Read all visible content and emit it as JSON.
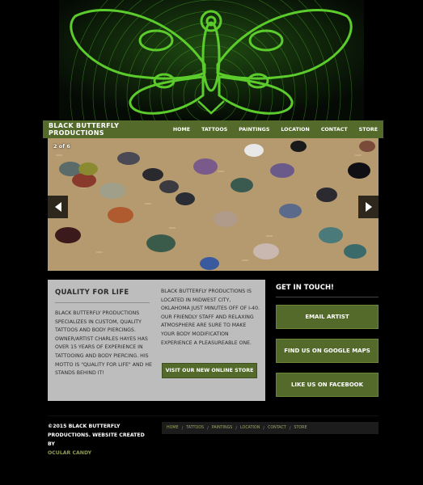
{
  "site": {
    "brand": "Black Butterfly Productions",
    "nav": [
      "Home",
      "Tattoos",
      "Paintings",
      "Location",
      "Contact",
      "Store"
    ]
  },
  "slider": {
    "counter": "2 of 6",
    "prev_icon": "arrow-left-icon",
    "next_icon": "arrow-right-icon"
  },
  "about": {
    "title": "Quality for Life",
    "col1": "Black Butterfly Productions specializes in custom, quality tattoos and body piercings. Owner/Artist Charles Hayes has over 15 years of experience in tattooing and body piercing. His motto is \"Quality for Life\" and he stands behind it!",
    "col2": "Black Butterfly Productions is located in Midwest City, Oklahoma just minutes off of I-40. Our friendly staff and relaxing atmosphere are sure to make your body modification experience a pleasureable one.",
    "store_button": "Visit our new online store"
  },
  "contact": {
    "title": "Get in Touch!",
    "buttons": [
      "Email Artist",
      "Find us on Google Maps",
      "Like us on Facebook"
    ]
  },
  "footer": {
    "copyright": "©2015 Black Butterfly Productions. Website created by",
    "credit": "Ocular Candy",
    "links": [
      "Home",
      "Tattoos",
      "Paintings",
      "Location",
      "Contact",
      "Store"
    ]
  },
  "colors": {
    "accent_green": "#536a2a",
    "hero_line_green": "#4fb52a",
    "about_bg": "#bdbdbd",
    "background": "#000000"
  }
}
